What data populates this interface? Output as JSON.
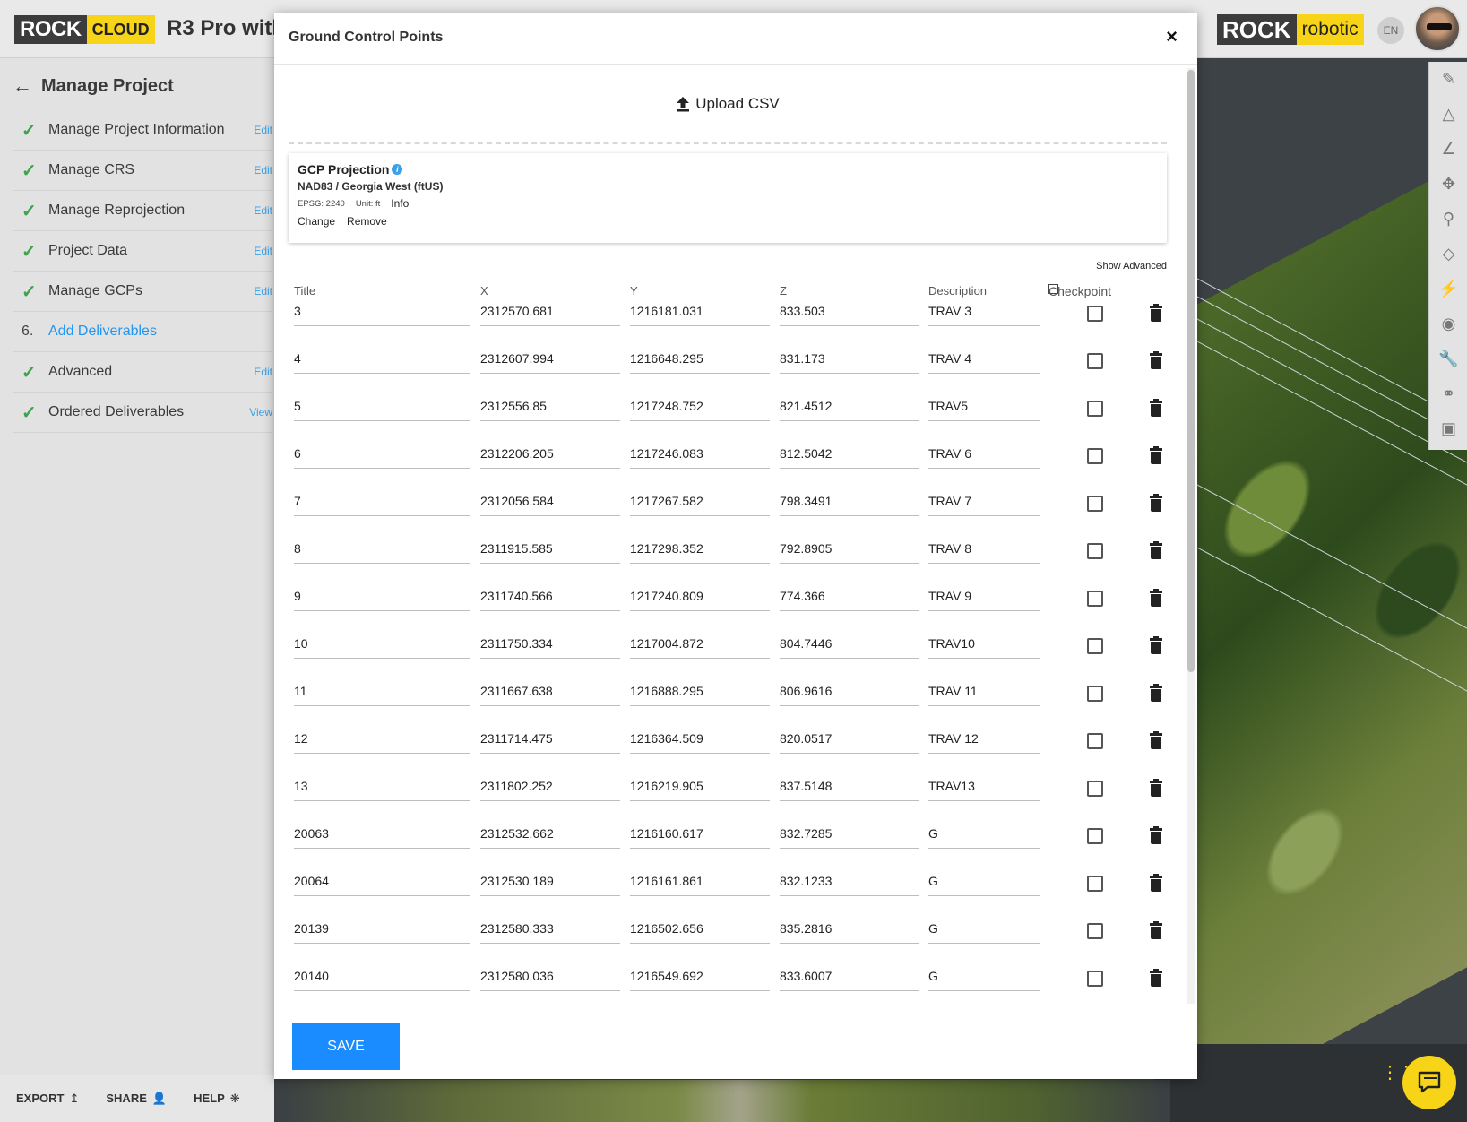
{
  "header": {
    "logo_left": {
      "rock": "ROCK",
      "cloud": "CLOUD"
    },
    "project_title": "R3 Pro with",
    "logo_right": {
      "rock": "ROCK",
      "robotic": "robotic"
    },
    "language": "EN"
  },
  "sidebar": {
    "back_title": "Manage Project",
    "items": [
      {
        "status": "done",
        "label": "Manage Project Information",
        "action": "Edit"
      },
      {
        "status": "done",
        "label": "Manage CRS",
        "action": "Edit"
      },
      {
        "status": "done",
        "label": "Manage Reprojection",
        "action": "Edit"
      },
      {
        "status": "done",
        "label": "Project Data",
        "action": "Edit"
      },
      {
        "status": "done",
        "label": "Manage GCPs",
        "action": "Edit"
      },
      {
        "status": "pending",
        "number": "6.",
        "label": "Add Deliverables",
        "action": ""
      },
      {
        "status": "done",
        "label": "Advanced",
        "action": "Edit"
      },
      {
        "status": "done",
        "label": "Ordered Deliverables",
        "action": "View"
      }
    ],
    "bottom": {
      "export": "EXPORT",
      "share": "SHARE",
      "help": "HELP"
    }
  },
  "modal": {
    "title": "Ground Control Points",
    "close": "×",
    "upload_label": "Upload CSV",
    "projection": {
      "heading": "GCP Projection",
      "crs_name": "NAD83 / Georgia West (ftUS)",
      "epsg": "EPSG: 2240",
      "unit": "Unit: ft",
      "info": "Info",
      "change": "Change",
      "remove": "Remove"
    },
    "show_advanced": "Show Advanced",
    "columns": {
      "title": "Title",
      "x": "X",
      "y": "Y",
      "z": "Z",
      "description": "Description",
      "checkpoint": "Checkpoint"
    },
    "rows": [
      {
        "title": "3",
        "x": "2312570.681",
        "y": "1216181.031",
        "z": "833.503",
        "description": "TRAV 3",
        "checkpoint": false
      },
      {
        "title": "4",
        "x": "2312607.994",
        "y": "1216648.295",
        "z": "831.173",
        "description": "TRAV 4",
        "checkpoint": false
      },
      {
        "title": "5",
        "x": "2312556.85",
        "y": "1217248.752",
        "z": "821.4512",
        "description": "TRAV5",
        "checkpoint": false
      },
      {
        "title": "6",
        "x": "2312206.205",
        "y": "1217246.083",
        "z": "812.5042",
        "description": "TRAV 6",
        "checkpoint": false
      },
      {
        "title": "7",
        "x": "2312056.584",
        "y": "1217267.582",
        "z": "798.3491",
        "description": "TRAV 7",
        "checkpoint": false
      },
      {
        "title": "8",
        "x": "2311915.585",
        "y": "1217298.352",
        "z": "792.8905",
        "description": "TRAV 8",
        "checkpoint": false
      },
      {
        "title": "9",
        "x": "2311740.566",
        "y": "1217240.809",
        "z": "774.366",
        "description": "TRAV 9",
        "checkpoint": false
      },
      {
        "title": "10",
        "x": "2311750.334",
        "y": "1217004.872",
        "z": "804.7446",
        "description": "TRAV10",
        "checkpoint": false
      },
      {
        "title": "11",
        "x": "2311667.638",
        "y": "1216888.295",
        "z": "806.9616",
        "description": "TRAV 11",
        "checkpoint": false
      },
      {
        "title": "12",
        "x": "2311714.475",
        "y": "1216364.509",
        "z": "820.0517",
        "description": "TRAV 12",
        "checkpoint": false
      },
      {
        "title": "13",
        "x": "2311802.252",
        "y": "1216219.905",
        "z": "837.5148",
        "description": "TRAV13",
        "checkpoint": false
      },
      {
        "title": "20063",
        "x": "2312532.662",
        "y": "1216160.617",
        "z": "832.7285",
        "description": "G",
        "checkpoint": false
      },
      {
        "title": "20064",
        "x": "2312530.189",
        "y": "1216161.861",
        "z": "832.1233",
        "description": "G",
        "checkpoint": false
      },
      {
        "title": "20139",
        "x": "2312580.333",
        "y": "1216502.656",
        "z": "835.2816",
        "description": "G",
        "checkpoint": false
      },
      {
        "title": "20140",
        "x": "2312580.036",
        "y": "1216549.692",
        "z": "833.6007",
        "description": "G",
        "checkpoint": false
      }
    ],
    "save_label": "SAVE"
  },
  "toolbar_icons": [
    "pencil-icon",
    "area-icon",
    "angle-icon",
    "move-icon",
    "pin-icon",
    "layers-icon",
    "lightning-icon",
    "eye-icon",
    "wrench-icon",
    "link-icon",
    "save-icon"
  ],
  "colors": {
    "accent_blue": "#1a8cff",
    "brand_yellow": "#f7d417",
    "check_green": "#3fa34d",
    "link_blue": "#3aa0e8"
  }
}
